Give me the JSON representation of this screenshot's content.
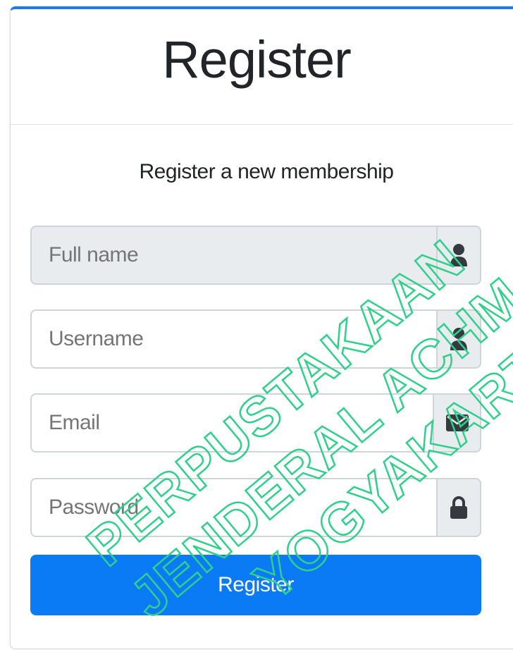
{
  "header": {
    "title": "Register"
  },
  "form": {
    "subtitle": "Register a new membership",
    "fields": [
      {
        "placeholder": "Full name",
        "value": "",
        "icon": "user-icon",
        "disabled": true
      },
      {
        "placeholder": "Username",
        "value": "",
        "icon": "user-icon",
        "disabled": false
      },
      {
        "placeholder": "Email",
        "value": "",
        "icon": "envelope-icon",
        "disabled": false
      },
      {
        "placeholder": "Password",
        "value": "",
        "icon": "lock-icon",
        "disabled": false
      }
    ],
    "submit_label": "Register"
  },
  "watermark": {
    "lines": [
      "PERPUSTAKAAN",
      "JENDERAL ACHMAD YANI",
      "YOGYAKARTA"
    ],
    "color": "#2fd08a"
  },
  "colors": {
    "accent": "#0b7bf5",
    "card_top_border": "#1a7bf0",
    "addon_bg": "#e9ecef"
  }
}
